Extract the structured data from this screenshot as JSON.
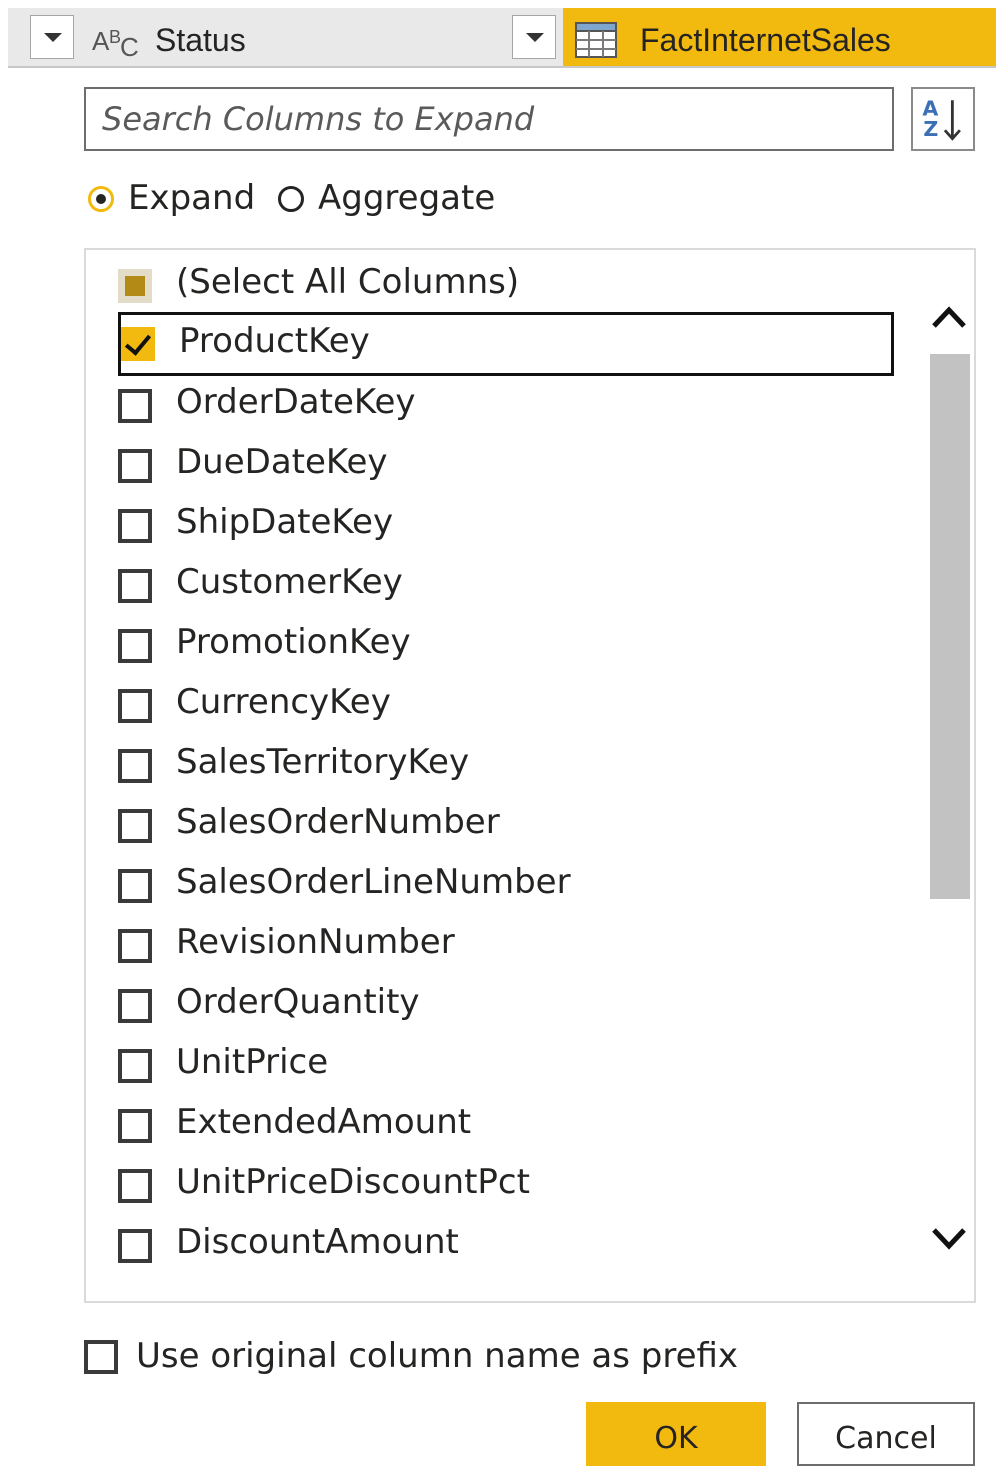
{
  "header": {
    "type_icon_text": {
      "a": "A",
      "b": "B",
      "c": "C"
    },
    "column_name": "Status",
    "table_name": "FactInternetSales",
    "accent_color": "#f2b90f"
  },
  "search": {
    "placeholder": "Search Columns to Expand",
    "value": ""
  },
  "sort_icon": {
    "top": "A",
    "bottom": "Z"
  },
  "mode": {
    "selected": "Expand",
    "options": [
      "Expand",
      "Aggregate"
    ]
  },
  "columns": {
    "items": [
      {
        "label": "(Select All Columns)",
        "state": "partial"
      },
      {
        "label": "ProductKey",
        "state": "checked"
      },
      {
        "label": "OrderDateKey",
        "state": "unchecked"
      },
      {
        "label": "DueDateKey",
        "state": "unchecked"
      },
      {
        "label": "ShipDateKey",
        "state": "unchecked"
      },
      {
        "label": "CustomerKey",
        "state": "unchecked"
      },
      {
        "label": "PromotionKey",
        "state": "unchecked"
      },
      {
        "label": "CurrencyKey",
        "state": "unchecked"
      },
      {
        "label": "SalesTerritoryKey",
        "state": "unchecked"
      },
      {
        "label": "SalesOrderNumber",
        "state": "unchecked"
      },
      {
        "label": "SalesOrderLineNumber",
        "state": "unchecked"
      },
      {
        "label": "RevisionNumber",
        "state": "unchecked"
      },
      {
        "label": "OrderQuantity",
        "state": "unchecked"
      },
      {
        "label": "UnitPrice",
        "state": "unchecked"
      },
      {
        "label": "ExtendedAmount",
        "state": "unchecked"
      },
      {
        "label": "UnitPriceDiscountPct",
        "state": "unchecked"
      },
      {
        "label": "DiscountAmount",
        "state": "unchecked"
      }
    ]
  },
  "prefix_option": {
    "label": "Use original column name as prefix",
    "checked": false
  },
  "buttons": {
    "ok": "OK",
    "cancel": "Cancel"
  }
}
